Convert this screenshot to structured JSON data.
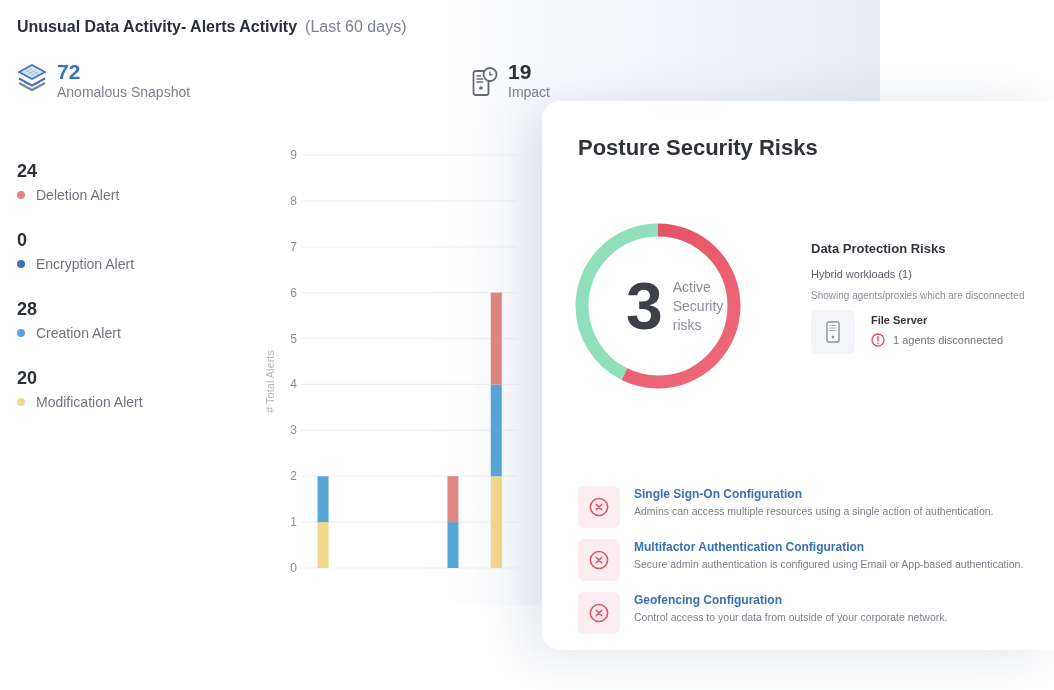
{
  "header": {
    "title": "Unusual Data Activity- Alerts Activity",
    "period": "(Last 60 days)"
  },
  "stats": [
    {
      "kind": "snapshot",
      "value": "72",
      "label": "Anomalous Snapshot"
    },
    {
      "kind": "resources",
      "value": "19",
      "label": "Impact"
    }
  ],
  "chart": {
    "alert_totals": [
      "24",
      "0",
      "28",
      "20"
    ],
    "chart_data": {
      "type": "bar",
      "ylabel": "# Total Alerts",
      "categories": [
        null,
        null,
        null,
        null,
        null
      ],
      "ylim": [
        0,
        9
      ],
      "yticks": [
        0,
        1,
        2,
        3,
        4,
        5,
        6,
        7,
        8,
        9
      ],
      "grid": true,
      "stacked": true,
      "orientation": "vertical",
      "series": [
        {
          "name": "Modification Alert",
          "color": "#f1d88a",
          "values": [
            1,
            0,
            0,
            0,
            2
          ]
        },
        {
          "name": "Creation Alert",
          "color": "#57a6d8",
          "values": [
            1,
            0,
            0,
            1,
            2
          ]
        },
        {
          "name": "Encryption Alert",
          "color": "#3f6fb6",
          "values": [
            0,
            0,
            0,
            0,
            0
          ]
        },
        {
          "name": "Deletion Alert",
          "color": "#e0877f",
          "values": [
            0,
            0,
            0,
            1,
            2
          ]
        }
      ]
    }
  },
  "posture": {
    "title": "Posture Security Risks",
    "total": "3",
    "total_label": "Active Security risks"
  },
  "data_protection": {
    "title": "Data Protection Risks",
    "subtitle": "Hybrid workloads (1)",
    "note": "Showing agents/proxies which are disconnected",
    "resources": [
      {
        "name": "File Server",
        "status": "1 agents disconnected"
      }
    ]
  },
  "risks": [
    {
      "title": "Single Sign-On Configuration",
      "description": "Admins can access multiple resources using a single action of authentication."
    },
    {
      "title": "Multifactor Authentication Configuration",
      "description": "Secure admin authentication is configured using Email or App-based authentication."
    },
    {
      "title": "Geofencing Configuration",
      "description": "Control access to your data from outside of your corporate network."
    }
  ]
}
